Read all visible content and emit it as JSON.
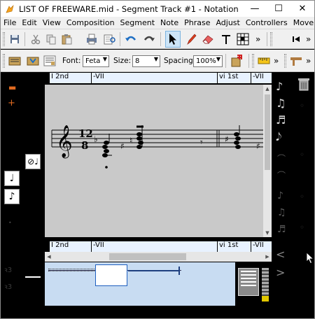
{
  "window": {
    "title": "LIST OF FREEWARE.mid - Segment Track #1 - Notation",
    "min_glyph": "—",
    "max_glyph": "☐",
    "close_glyph": "✕"
  },
  "menu": [
    "File",
    "Edit",
    "View",
    "Composition",
    "Segment",
    "Note",
    "Phrase",
    "Adjust",
    "Controllers",
    "Move"
  ],
  "toolbar2": {
    "font_label": "Font:",
    "font_value": "Feta",
    "size_label": "Size:",
    "size_value": "8",
    "spacing_label": "Spacing:",
    "spacing_value": "100%",
    "more": "»"
  },
  "toolbar1": {
    "more": "»"
  },
  "markers_top": [
    "I 2nd",
    "-VII",
    "vi 1st",
    "-VII"
  ],
  "markers_bottom": [
    "I 2nd",
    "-VII",
    "vi 1st",
    "-VII"
  ],
  "score": {
    "time_sig_top": "12",
    "time_sig_bottom": "8"
  },
  "colors": {
    "accent": "#0078d7",
    "score_bg": "#c9c9c9",
    "marker_bg": "#e8f2ff",
    "overview_bg": "#c8dcf2"
  }
}
